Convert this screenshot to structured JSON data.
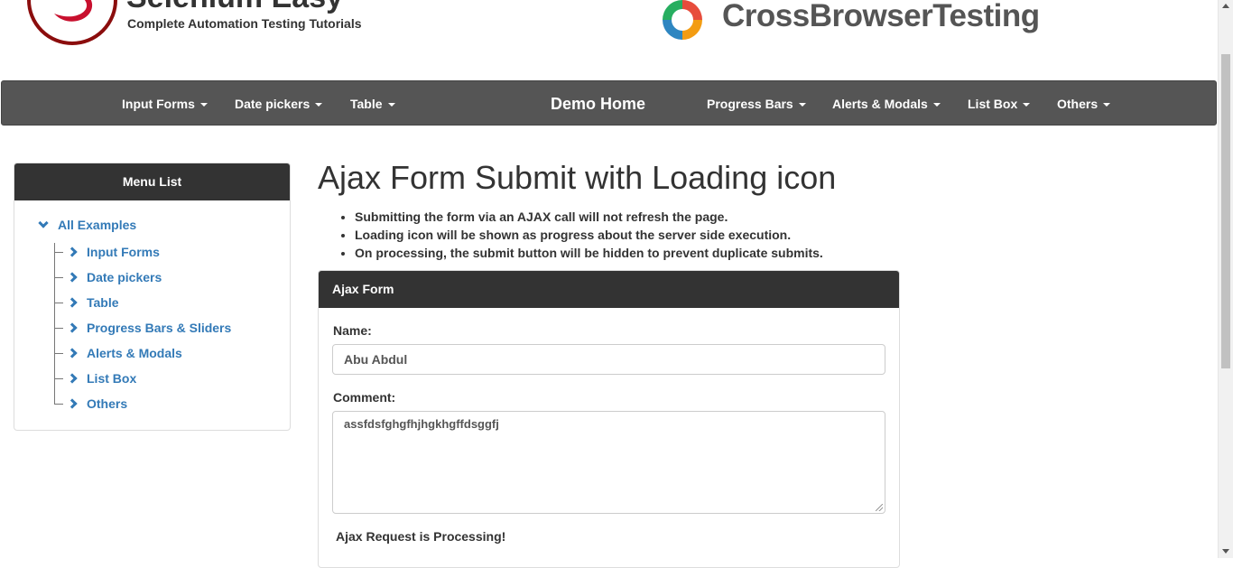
{
  "header": {
    "brand_title": "Selenium Easy",
    "brand_subtitle": "Complete Automation Testing Tutorials",
    "partner_name": "CrossBrowserTesting",
    "brand_color": "#c8102e"
  },
  "navbar": {
    "left_items": [
      "Input Forms",
      "Date pickers",
      "Table"
    ],
    "home": "Demo Home",
    "right_items": [
      "Progress Bars",
      "Alerts & Modals",
      "List Box",
      "Others"
    ],
    "background": "#555555"
  },
  "sidebar": {
    "title": "Menu List",
    "root": "All Examples",
    "items": [
      {
        "label": "Input Forms"
      },
      {
        "label": "Date pickers"
      },
      {
        "label": "Table"
      },
      {
        "label": "Progress Bars & Sliders"
      },
      {
        "label": "Alerts & Modals"
      },
      {
        "label": "List Box"
      },
      {
        "label": "Others"
      }
    ],
    "link_color": "#337ab7"
  },
  "main": {
    "title": "Ajax Form Submit with Loading icon",
    "bullets": [
      "Submitting the form via an AJAX call will not refresh the page.",
      "Loading icon will be shown as progress about the server side execution.",
      "On processing, the submit button will be hidden to prevent duplicate submits."
    ]
  },
  "form": {
    "title": "Ajax Form",
    "name_label": "Name:",
    "name_value": "Abu Abdul",
    "comment_label": "Comment:",
    "comment_value": "assfdsfghgfhjhgkhgffdsggfj",
    "status": "Ajax Request is Processing!"
  }
}
